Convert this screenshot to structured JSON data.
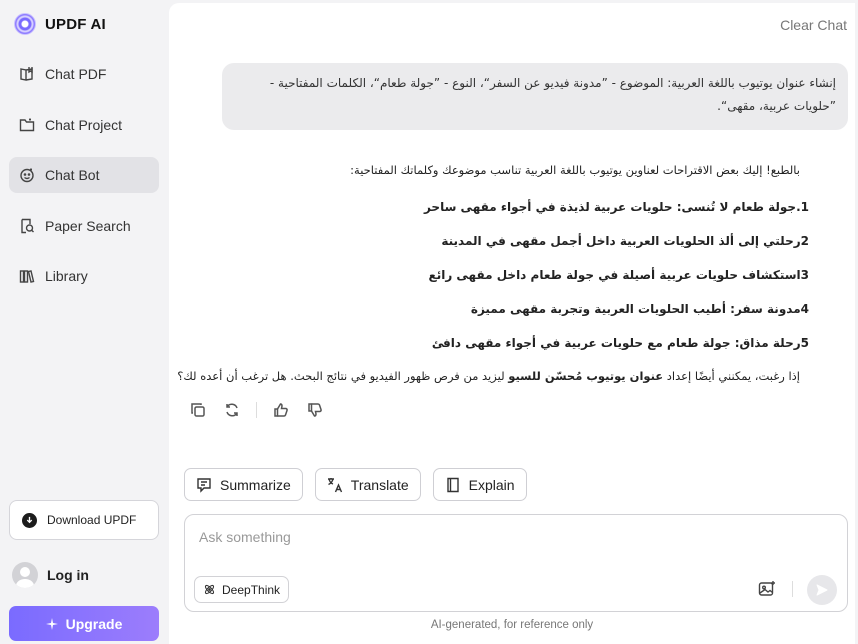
{
  "brand": {
    "name": "UPDF AI"
  },
  "sidebar": {
    "items": [
      {
        "label": "Chat PDF",
        "icon": "book-icon"
      },
      {
        "label": "Chat Project",
        "icon": "folder-icon"
      },
      {
        "label": "Chat Bot",
        "icon": "bot-icon",
        "active": true
      },
      {
        "label": "Paper Search",
        "icon": "search-doc-icon"
      },
      {
        "label": "Library",
        "icon": "library-icon"
      }
    ],
    "download_label": "Download UPDF",
    "login_label": "Log in",
    "upgrade_label": "Upgrade"
  },
  "header": {
    "clear_chat": "Clear Chat"
  },
  "user_message": "إنشاء عنوان يوتيوب باللغة العربية: الموضوع - ”مدونة فيديو عن السفر“، النوع - ”جولة طعام“، الكلمات المفتاحية - ”حلويات عربية، مقهى“.",
  "answer": {
    "intro": "بالطبع! إليك بعض الاقتراحات لعناوين يوتيوب باللغة العربية تناسب موضوعك وكلماتك المفتاحية:",
    "items": [
      "1.جولة طعام لا تُنسى: حلويات عربية لذيذة في أجواء مقهى ساحر",
      "2رحلتي إلى ألذ الحلويات العربية داخل أجمل مقهى في المدينة",
      "3استكشاف حلويات عربية أصيلة في جولة طعام داخل مقهى رائع",
      "4مدونة سفر: أطيب الحلويات العربية وتجربة مقهى مميزة",
      "5رحلة مذاق: جولة طعام مع حلويات عربية في أجواء مقهى دافئ"
    ],
    "outro_pre": "إذا رغبت، يمكنني أيضًا إعداد ",
    "outro_bold": "عنوان يوتيوب مُحسّن للسيو",
    "outro_post": " ليزيد من فرص ظهور الفيديو في نتائج البحث. هل ترغب أن أعده لك؟"
  },
  "chips": {
    "summarize": "Summarize",
    "translate": "Translate",
    "explain": "Explain"
  },
  "input": {
    "placeholder": "Ask something",
    "deepthink": "DeepThink"
  },
  "footnote": "AI-generated, for reference only",
  "colors": {
    "accent": "#7a6bff",
    "active_bg": "#e2e2e6"
  }
}
